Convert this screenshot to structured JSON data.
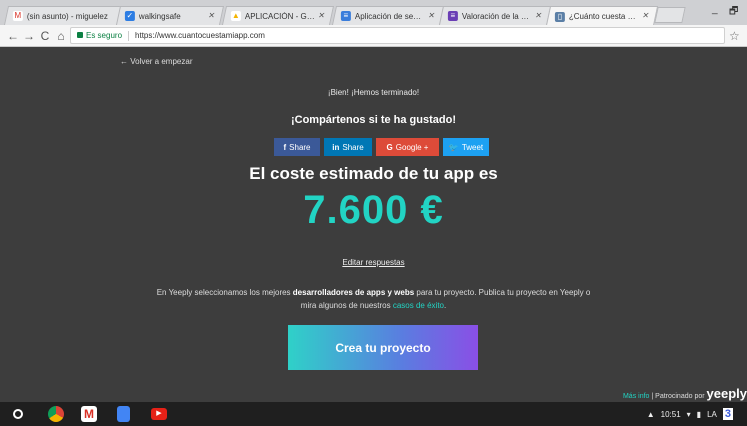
{
  "tabs": [
    {
      "title": "(sin asunto) - miguelez",
      "icon": "gmail-icon",
      "color": "#d93025",
      "glyph": "M"
    },
    {
      "title": "walkingsafe",
      "icon": "tasks-icon",
      "color": "#2d7de3",
      "glyph": "✓"
    },
    {
      "title": "APLICACIÓN - Google D",
      "icon": "drive-icon",
      "color": "#f4b400",
      "glyph": "▲"
    },
    {
      "title": "Aplicación de segurida",
      "icon": "forms-icon",
      "color": "#3a7ddb",
      "glyph": "≡"
    },
    {
      "title": "Valoración de la clase",
      "icon": "forms-icon",
      "color": "#6a3eb5",
      "glyph": "≡"
    },
    {
      "title": "¿Cuánto cuesta desarro",
      "icon": "page-icon",
      "color": "#5b7fa6",
      "glyph": "▯"
    }
  ],
  "window": {
    "minimize": "_",
    "restore": "🗗"
  },
  "address": {
    "secure_label": "Es seguro",
    "url": "https://www.cuantocuestamiapp.com"
  },
  "page": {
    "back_link": "← Volver a empezar",
    "done_text": "¡Bien! ¡Hemos terminado!",
    "share_title": "¡Compártenos si te ha gustado!",
    "share_buttons": [
      {
        "icon": "f",
        "label": "Share"
      },
      {
        "icon": "in",
        "label": "Share"
      },
      {
        "icon": "G",
        "label": "Google +"
      },
      {
        "icon": "🐦",
        "label": "Tweet"
      }
    ],
    "estimate_title": "El coste estimado de tu app es",
    "price": "7.600 €",
    "edit_link": "Editar respuestas",
    "desc_part1": "En Yeeply seleccionamos los mejores ",
    "desc_bold": "desarrolladores de apps y webs",
    "desc_part2": " para tu proyecto. Publica tu proyecto en Yeeply o",
    "desc_line2": "mira algunos de nuestros ",
    "desc_link": "casos de éxito",
    "desc_end": ".",
    "cta_label": "Crea tu proyecto",
    "more_info": "Más info",
    "sponsored_by": " | Patrocinado por ",
    "brand": "yeeply"
  },
  "tray": {
    "time": "10:51",
    "lang": "LA",
    "badge": "3"
  }
}
